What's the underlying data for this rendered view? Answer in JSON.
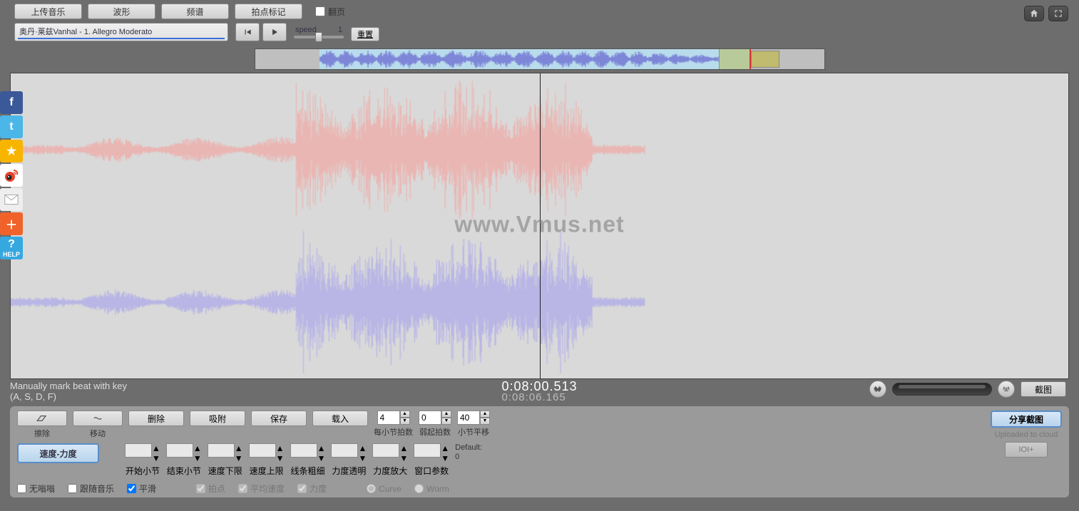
{
  "toolbar": {
    "upload": "上传音乐",
    "waveform": "波形",
    "spectrum": "频谱",
    "beatmark": "拍点标记",
    "flip": "翻页"
  },
  "track": {
    "title": "奥丹·莱兹Vanhal  - 1. Allegro Moderato"
  },
  "speed": {
    "label": "speed",
    "value": "1",
    "reset": "重置"
  },
  "watermark": "www.Vmus.net",
  "status": {
    "hint_line1": "Manually mark beat with key",
    "hint_line2": "(A, S, D, F)",
    "time1": "0:08:00.513",
    "time2": "0:08:06.165",
    "screenshot": "截图"
  },
  "bottom": {
    "erase": "擦除",
    "move": "移动",
    "delete": "删除",
    "snap": "吸附",
    "save": "保存",
    "load": "载入",
    "beats_per_bar": {
      "value": "4",
      "label": "每小节拍数"
    },
    "pickup_beats": {
      "value": "0",
      "label": "弱起拍数"
    },
    "bar_offset": {
      "value": "40",
      "label": "小节平移"
    },
    "tempo_dynamics": "速度-力度",
    "start_bar": "开始小节",
    "end_bar": "结束小节",
    "tempo_min": "速度下限",
    "tempo_max": "速度上限",
    "line_thick": "线条粗细",
    "dyn_trans": "力度透明",
    "dyn_zoom": "力度放大",
    "window_params": "窗口参数",
    "default_label": "Default:",
    "default_value": "0",
    "no_drone": "无嗡嗡",
    "follow": "跟随音乐",
    "smooth": "平滑",
    "beat": "拍点",
    "avg_tempo": "平均速度",
    "dynamics": "力度",
    "curve": "Curve",
    "worm": "Worm",
    "share": "分享截图",
    "cloud": "Uploaded to cloud",
    "ioi": "IOI+"
  }
}
